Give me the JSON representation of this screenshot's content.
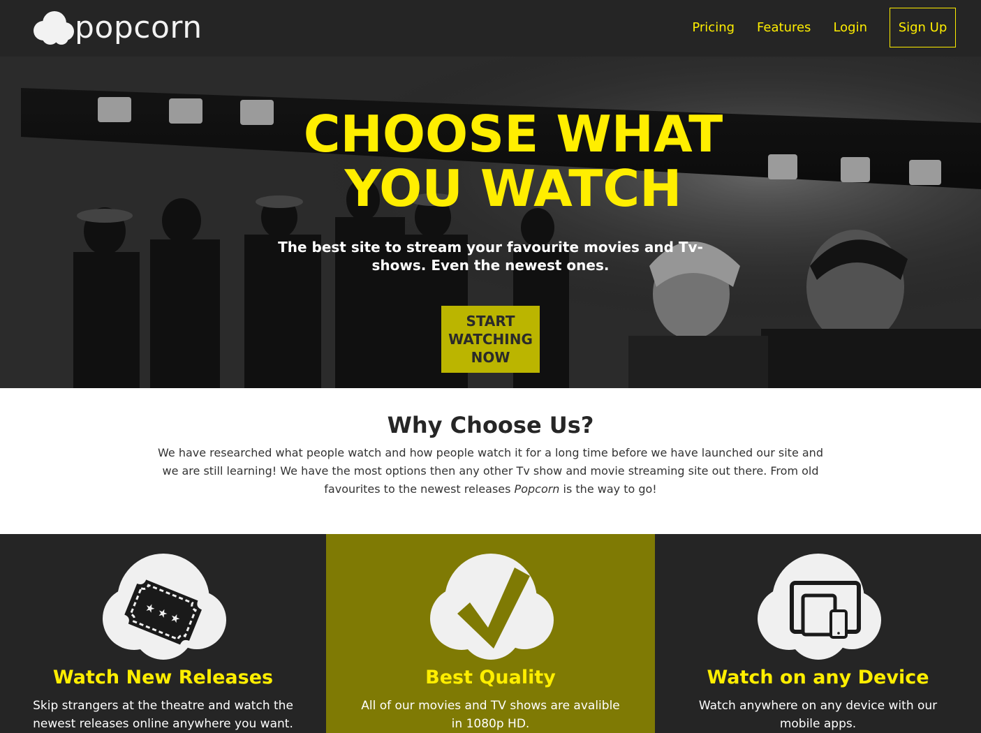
{
  "brand": {
    "name": "popcorn"
  },
  "nav": {
    "pricing": "Pricing",
    "features": "Features",
    "login": "Login",
    "signup": "Sign Up"
  },
  "hero": {
    "title_line1": "CHOOSE WHAT",
    "title_line2": "YOU WATCH",
    "subtitle": "The best site to stream your favourite movies and Tv-shows. Even the newest ones.",
    "cta": "START WATCHING NOW"
  },
  "why": {
    "title": "Why Choose Us?",
    "text_part1": "We have researched what people watch and how people watch it for a long time before we have launched our site and we are still learning! We have the most options then any other Tv show and movie streaming site out there. From old favourites to the newest releases ",
    "text_emphasis": "Popcorn",
    "text_part2": " is the way to go!"
  },
  "features": [
    {
      "title": "Watch New Releases",
      "text": "Skip strangers at the theatre and watch the newest releases online anywhere you want.",
      "icon": "ticket-icon"
    },
    {
      "title": "Best Quality",
      "text": "All of our movies and TV shows are avalible in 1080p HD.",
      "icon": "checkmark-icon"
    },
    {
      "title": "Watch on any Device",
      "text": "Watch anywhere on any device with our mobile apps.",
      "icon": "devices-icon"
    }
  ],
  "colors": {
    "accent": "#ffee00",
    "dark": "#252525",
    "olive": "#7f7a04",
    "cta": "#bbb500"
  }
}
